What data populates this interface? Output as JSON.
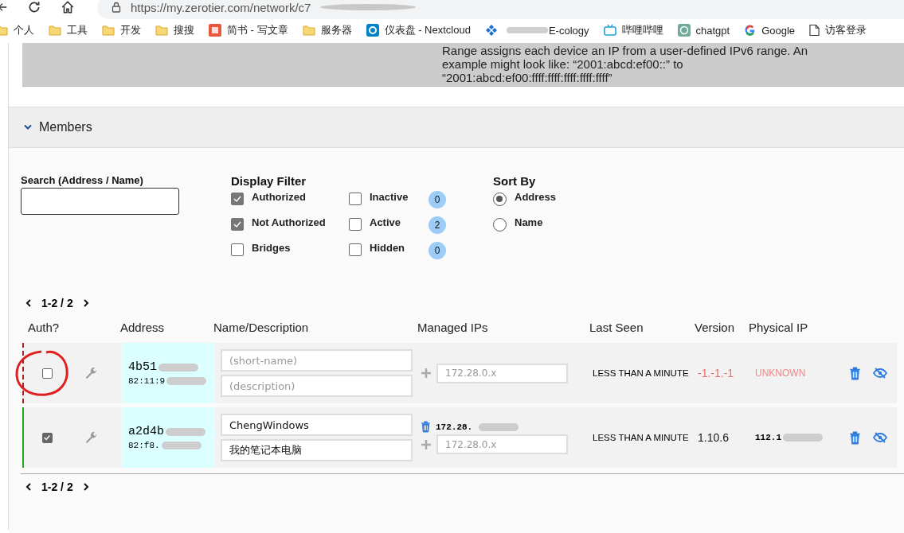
{
  "browser": {
    "url": "https://my.zerotier.com/network/c7",
    "bookmarks": [
      {
        "label": "个人",
        "kind": "folder"
      },
      {
        "label": "工具",
        "kind": "folder"
      },
      {
        "label": "开发",
        "kind": "folder"
      },
      {
        "label": "搜搜",
        "kind": "folder"
      },
      {
        "label": "简书 - 写文章",
        "kind": "square"
      },
      {
        "label": "服务器",
        "kind": "folder"
      },
      {
        "label": "仪表盘 - Nextcloud",
        "kind": "ring"
      },
      {
        "label": "E-cology",
        "kind": "diamond"
      },
      {
        "label": "哔哩哔哩",
        "kind": "tv"
      },
      {
        "label": "chatgpt",
        "kind": "knot"
      },
      {
        "label": "Google",
        "kind": "g"
      },
      {
        "label": "访客登录",
        "kind": "page"
      }
    ]
  },
  "note": {
    "lines": [
      "Range assigns each device an IP from a user-defined IPv6 range. An",
      "example might look like: “2001:abcd:ef00::” to",
      "“2001:abcd:ef00:ffff:ffff:ffff:ffff:ffff”"
    ]
  },
  "members": {
    "title": "Members",
    "expanded": true,
    "search": {
      "label": "Search (Address / Name)"
    },
    "filter": {
      "title": "Display Filter",
      "columns": [
        [
          {
            "label": "Authorized",
            "checked": true
          },
          {
            "label": "Not Authorized",
            "checked": true
          },
          {
            "label": "Bridges",
            "checked": false
          }
        ],
        [
          {
            "label": "Inactive",
            "checked": false,
            "count": "0"
          },
          {
            "label": "Active",
            "checked": false,
            "count": "2"
          },
          {
            "label": "Hidden",
            "checked": false,
            "count": "0"
          }
        ]
      ]
    },
    "sort": {
      "title": "Sort By",
      "options": [
        {
          "label": "Address",
          "selected": true
        },
        {
          "label": "Name",
          "selected": false
        }
      ]
    },
    "pagination_top": "1-2 / 2",
    "columns": [
      "Auth?",
      "Address",
      "Name/Description",
      "Managed IPs",
      "Last Seen",
      "Version",
      "Physical IP"
    ],
    "rows": [
      {
        "authorized": false,
        "annotated": true,
        "address": "4b51",
        "mac": "82:11:9",
        "name": {
          "placeholder": "(short-name)"
        },
        "description": {
          "placeholder": "(description)"
        },
        "ips": [],
        "ip_placeholder": "172.28.0.x",
        "last_seen": "LESS THAN A MINUTE",
        "version": "-1.-1.-1",
        "physical_ip": "UNKNOWN",
        "online": false
      },
      {
        "authorized": true,
        "annotated": false,
        "address": "a2d4b",
        "mac": "82:f8.",
        "name": {
          "value": "ChengWindows"
        },
        "description": {
          "value": "我的笔记本电脑"
        },
        "ips": [
          "172.28."
        ],
        "ip_placeholder": "172.28.0.x",
        "last_seen": "LESS THAN A MINUTE",
        "version": "1.10.6",
        "physical_ip": "112.1",
        "online": true
      }
    ],
    "pagination_bottom": "1-2 / 2"
  }
}
